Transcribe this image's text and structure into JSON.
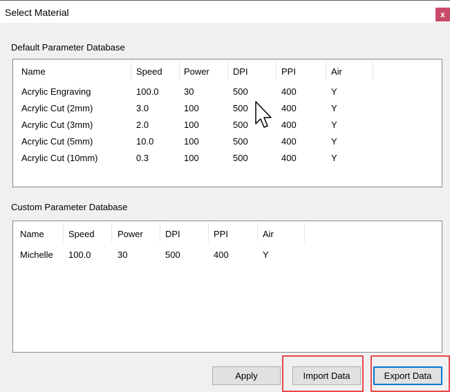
{
  "window": {
    "title": "Select Material",
    "close_glyph": "x"
  },
  "default_db": {
    "label": "Default Parameter Database",
    "columns": [
      "Name",
      "Speed",
      "Power",
      "DPI",
      "PPI",
      "Air"
    ],
    "rows": [
      [
        "Acrylic Engraving",
        "100.0",
        "30",
        "500",
        "400",
        "Y"
      ],
      [
        "Acrylic Cut (2mm)",
        "3.0",
        "100",
        "500",
        "400",
        "Y"
      ],
      [
        "Acrylic Cut (3mm)",
        "2.0",
        "100",
        "500",
        "400",
        "Y"
      ],
      [
        "Acrylic Cut (5mm)",
        "10.0",
        "100",
        "500",
        "400",
        "Y"
      ],
      [
        "Acrylic Cut (10mm)",
        "0.3",
        "100",
        "500",
        "400",
        "Y"
      ]
    ]
  },
  "custom_db": {
    "label": "Custom Parameter Database",
    "columns": [
      "Name",
      "Speed",
      "Power",
      "DPI",
      "PPI",
      "Air"
    ],
    "rows": [
      [
        "Michelle",
        "100.0",
        "30",
        "500",
        "400",
        "Y"
      ]
    ]
  },
  "buttons": {
    "apply": "Apply",
    "import": "Import Data",
    "export": "Export Data"
  },
  "colors": {
    "annotation": "#e8474a",
    "focus": "#0078d7",
    "close": "#c84b6a"
  }
}
